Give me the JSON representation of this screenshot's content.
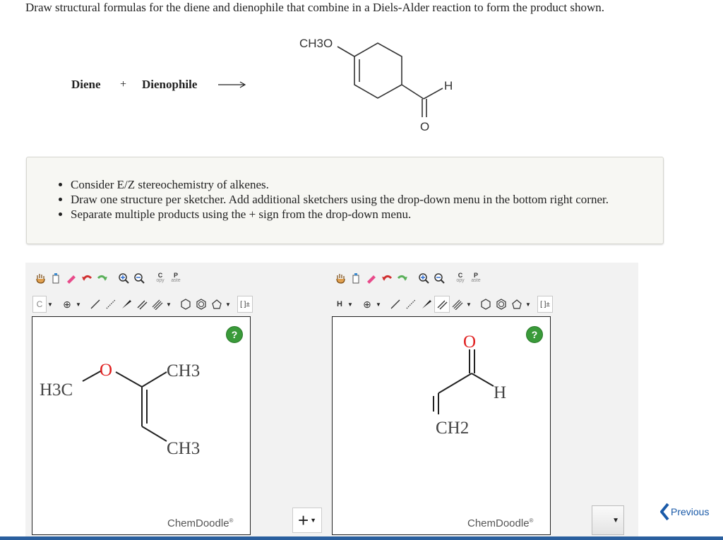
{
  "question": "Draw structural formulas for the diene and dienophile that combine in a Diels-Alder reaction to form the product shown.",
  "equation": {
    "diene_label": "Diene",
    "plus": "+",
    "dienophile_label": "Dienophile",
    "product_substituent": "CH3O",
    "product_h": "H",
    "product_o": "O"
  },
  "instructions": [
    "Consider E/Z stereochemistry of alkenes.",
    "Draw one structure per sketcher. Add additional sketchers using the drop-down menu in the bottom right corner.",
    "Separate multiple products using the + sign from the drop-down menu."
  ],
  "toolbar": {
    "copy_top": "C",
    "copy_bottom": "opy",
    "paste_top": "P",
    "paste_bottom": "aste",
    "charge": "[ ]±",
    "plus_circle": "⊕"
  },
  "sketcher1": {
    "atom_selector": "C",
    "help": "?",
    "brand": "ChemDoodle",
    "reg": "®",
    "molecule": {
      "h3c": "H3C",
      "o": "O",
      "ch3_top": "CH3",
      "ch3_bottom": "CH3"
    }
  },
  "sketcher2": {
    "atom_selector": "H",
    "help": "?",
    "brand": "ChemDoodle",
    "reg": "®",
    "molecule": {
      "o": "O",
      "h": "H",
      "ch2": "CH2"
    }
  },
  "add_sketcher": "+",
  "previous": "Previous",
  "colors": {
    "accent": "#1a5aa8",
    "oxygen": "#e02020",
    "help": "#3a9a3a",
    "bar": "#2a5f9e"
  }
}
